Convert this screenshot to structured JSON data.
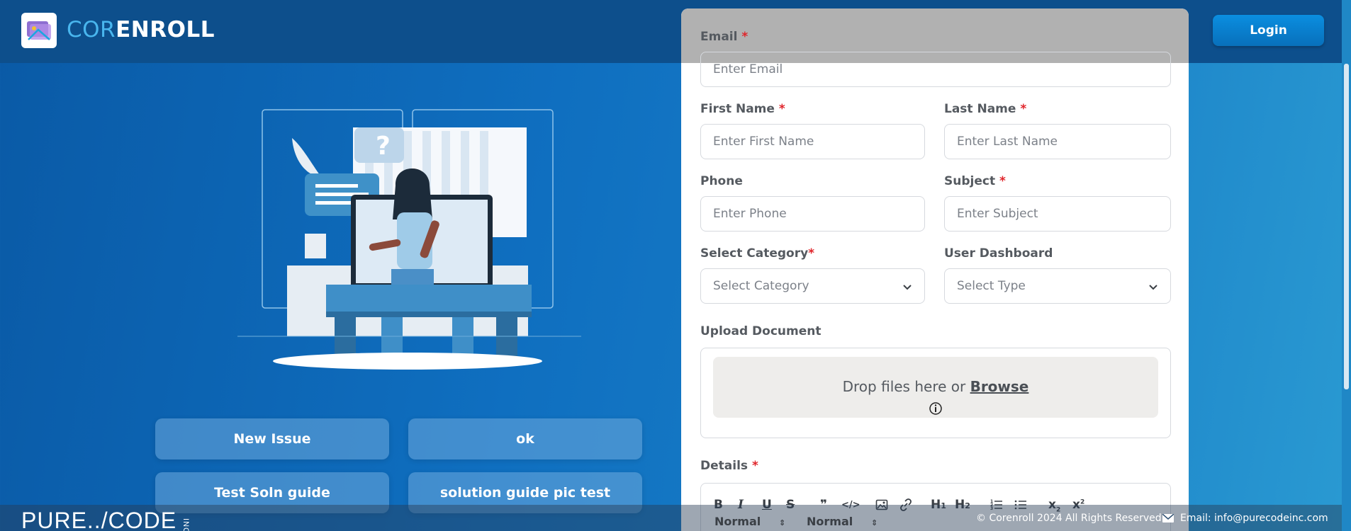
{
  "header": {
    "brand_part1": "COR",
    "brand_part2": "ENROLL",
    "login_label": "Login"
  },
  "actions": [
    "New Issue",
    "ok",
    "Test Soln guide",
    "solution guide pic test"
  ],
  "form": {
    "email_label": "Email",
    "email_placeholder": "Enter Email",
    "first_name_label": "First Name",
    "first_name_placeholder": "Enter First Name",
    "last_name_label": "Last Name",
    "last_name_placeholder": "Enter Last Name",
    "phone_label": "Phone",
    "phone_placeholder": "Enter Phone",
    "subject_label": "Subject",
    "subject_placeholder": "Enter Subject",
    "category_label": "Select Category",
    "category_value": "Select Category",
    "dashboard_label": "User Dashboard",
    "dashboard_value": "Select Type",
    "upload_label": "Upload Document",
    "drop_text": "Drop files here or ",
    "browse_text": "Browse",
    "details_label": "Details",
    "required_mark": "*"
  },
  "editor": {
    "tools": [
      "B",
      "I",
      "U",
      "S",
      "❞",
      "</>",
      "image",
      "link",
      "H1",
      "H2",
      "ol",
      "ul",
      "X2",
      "X2"
    ],
    "select1": "Normal",
    "select2": "Normal"
  },
  "footer": {
    "logo_text": "PURE../CODE",
    "logo_sub": "INC",
    "copyright": "© Corenroll 2024 All Rights Reserved.",
    "email": "Email: info@purecodeinc.com"
  },
  "colors": {
    "accent": "#0a8ee0",
    "required": "#e0242a"
  }
}
